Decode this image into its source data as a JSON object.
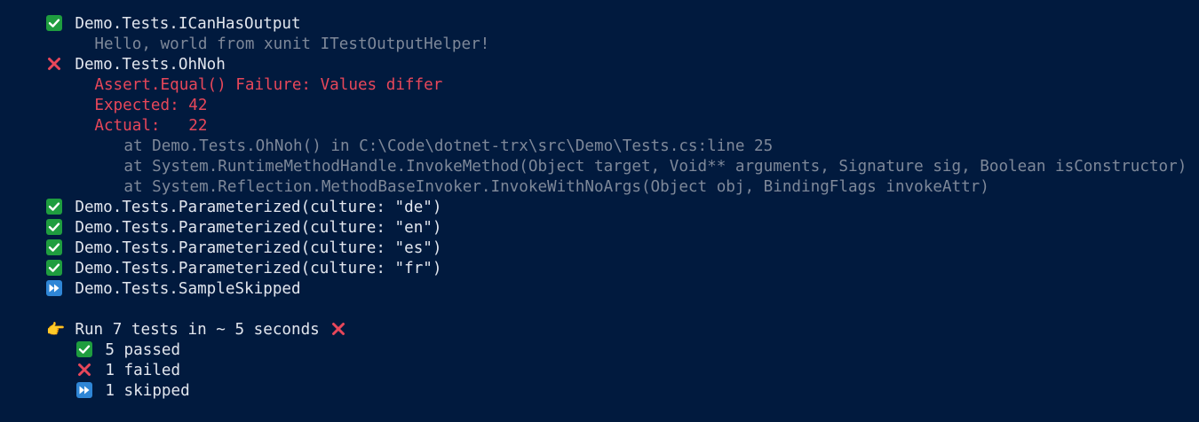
{
  "theme": {
    "background": "#011a3e",
    "text": "#e2e6ee",
    "muted": "#7e8899",
    "error": "#e8475a",
    "pass_icon": "#1f9d3f",
    "fail_icon": "#e8475a",
    "skip_icon": "#2f86d6"
  },
  "results": {
    "t1": {
      "name": "Demo.Tests.ICanHasOutput",
      "status": "passed",
      "icon": "check-box-icon",
      "output": "Hello, world from xunit ITestOutputHelper!"
    },
    "t2": {
      "name": "Demo.Tests.OhNoh",
      "status": "failed",
      "icon": "cross-icon",
      "message": "Assert.Equal() Failure: Values differ",
      "expected": "Expected: 42",
      "actual": "Actual:   22",
      "stack": [
        "at Demo.Tests.OhNoh() in C:\\Code\\dotnet-trx\\src\\Demo\\Tests.cs:line 25",
        "at System.RuntimeMethodHandle.InvokeMethod(Object target, Void** arguments, Signature sig, Boolean isConstructor)",
        "at System.Reflection.MethodBaseInvoker.InvokeWithNoArgs(Object obj, BindingFlags invokeAttr)"
      ]
    },
    "t3": {
      "name": "Demo.Tests.Parameterized(culture: \"de\")",
      "status": "passed",
      "icon": "check-box-icon"
    },
    "t4": {
      "name": "Demo.Tests.Parameterized(culture: \"en\")",
      "status": "passed",
      "icon": "check-box-icon"
    },
    "t5": {
      "name": "Demo.Tests.Parameterized(culture: \"es\")",
      "status": "passed",
      "icon": "check-box-icon"
    },
    "t6": {
      "name": "Demo.Tests.Parameterized(culture: \"fr\")",
      "status": "passed",
      "icon": "check-box-icon"
    },
    "t7": {
      "name": "Demo.Tests.SampleSkipped",
      "status": "skipped",
      "icon": "fast-forward-icon"
    }
  },
  "summary": {
    "icon": "pointing-hand-icon",
    "title": "Run 7 tests in ~ 5 seconds",
    "status_icon": "cross-icon",
    "passed": "5 passed",
    "failed": "1 failed",
    "skipped": "1 skipped"
  }
}
